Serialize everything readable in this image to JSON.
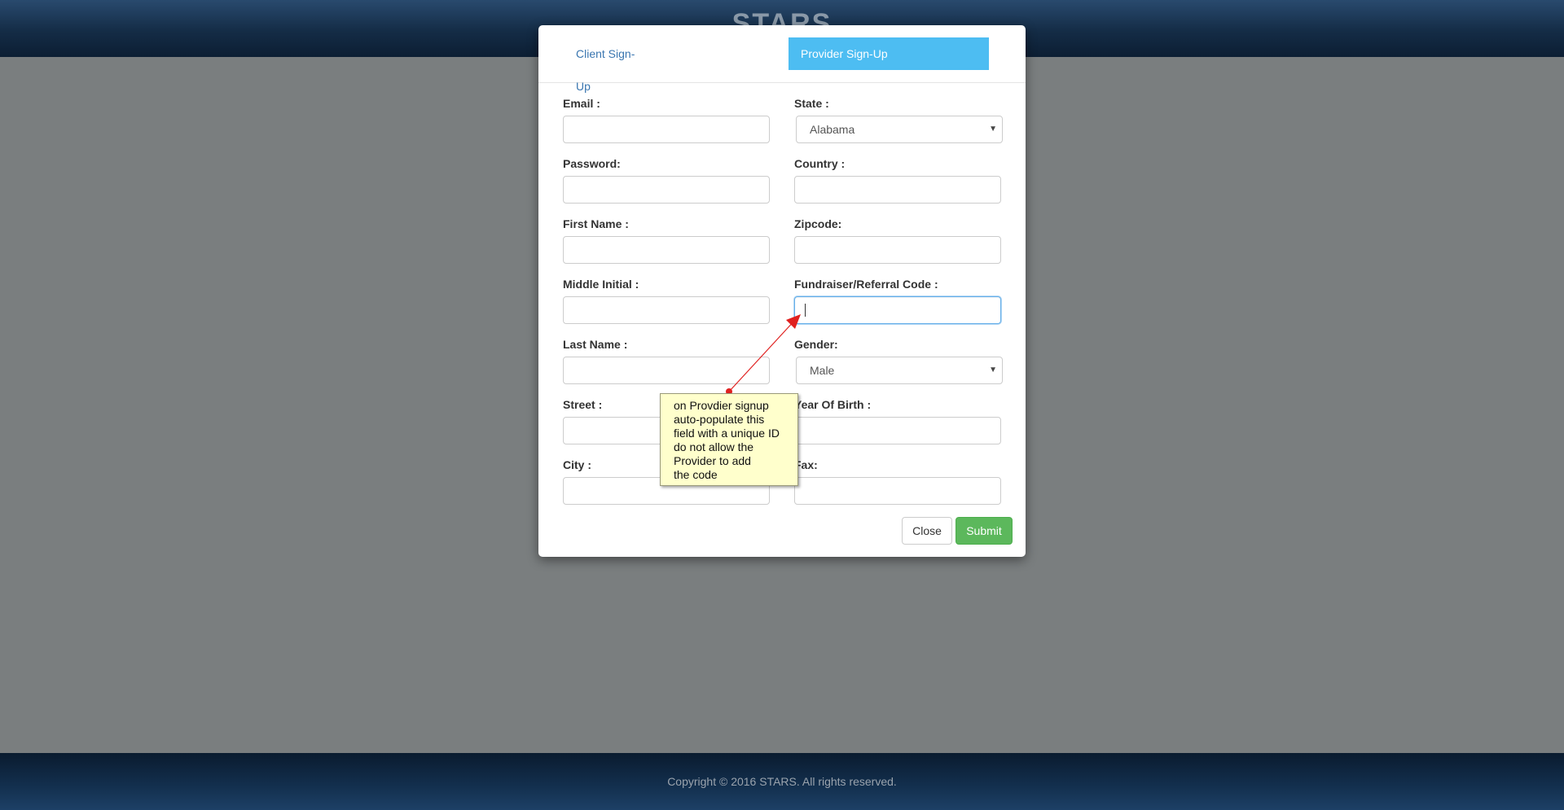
{
  "brand": {
    "name": "STARS"
  },
  "footer": {
    "copyright": "Copyright © 2016 STARS. All rights reserved."
  },
  "modal": {
    "tabs": [
      {
        "label": "Client Sign-Up",
        "active": false
      },
      {
        "label": "Provider Sign-Up",
        "active": true
      }
    ],
    "left_fields": [
      {
        "label": "Email :",
        "value": ""
      },
      {
        "label": "Password:",
        "value": ""
      },
      {
        "label": "First Name :",
        "value": ""
      },
      {
        "label": "Middle Initial :",
        "value": ""
      },
      {
        "label": "Last Name :",
        "value": ""
      },
      {
        "label": "Street :",
        "value": ""
      },
      {
        "label": "City :",
        "value": ""
      }
    ],
    "right_fields": {
      "state": {
        "label": "State :",
        "selected": "Alabama"
      },
      "country": {
        "label": "Country :",
        "value": ""
      },
      "zipcode": {
        "label": "Zipcode:",
        "value": ""
      },
      "referral": {
        "label": "Fundraiser/Referral Code :",
        "value": ""
      },
      "gender": {
        "label": "Gender:",
        "selected": "Male"
      },
      "year_of_birth": {
        "label": "Year Of Birth :",
        "value": ""
      },
      "fax": {
        "label": "Fax:",
        "value": ""
      }
    },
    "buttons": {
      "close": "Close",
      "submit": "Submit"
    }
  },
  "annotation": {
    "lines": [
      "on Provdier signup",
      "auto-populate this",
      "field with a unique ID",
      "do not allow the",
      "Provider to add",
      "the code"
    ],
    "arrow_color": "#e0201f"
  },
  "colors": {
    "tab_active_bg": "#4dbdf2",
    "submit_bg": "#5cb85c",
    "overlay_bg": "#7a7e7f",
    "note_bg": "#ffffcc"
  }
}
